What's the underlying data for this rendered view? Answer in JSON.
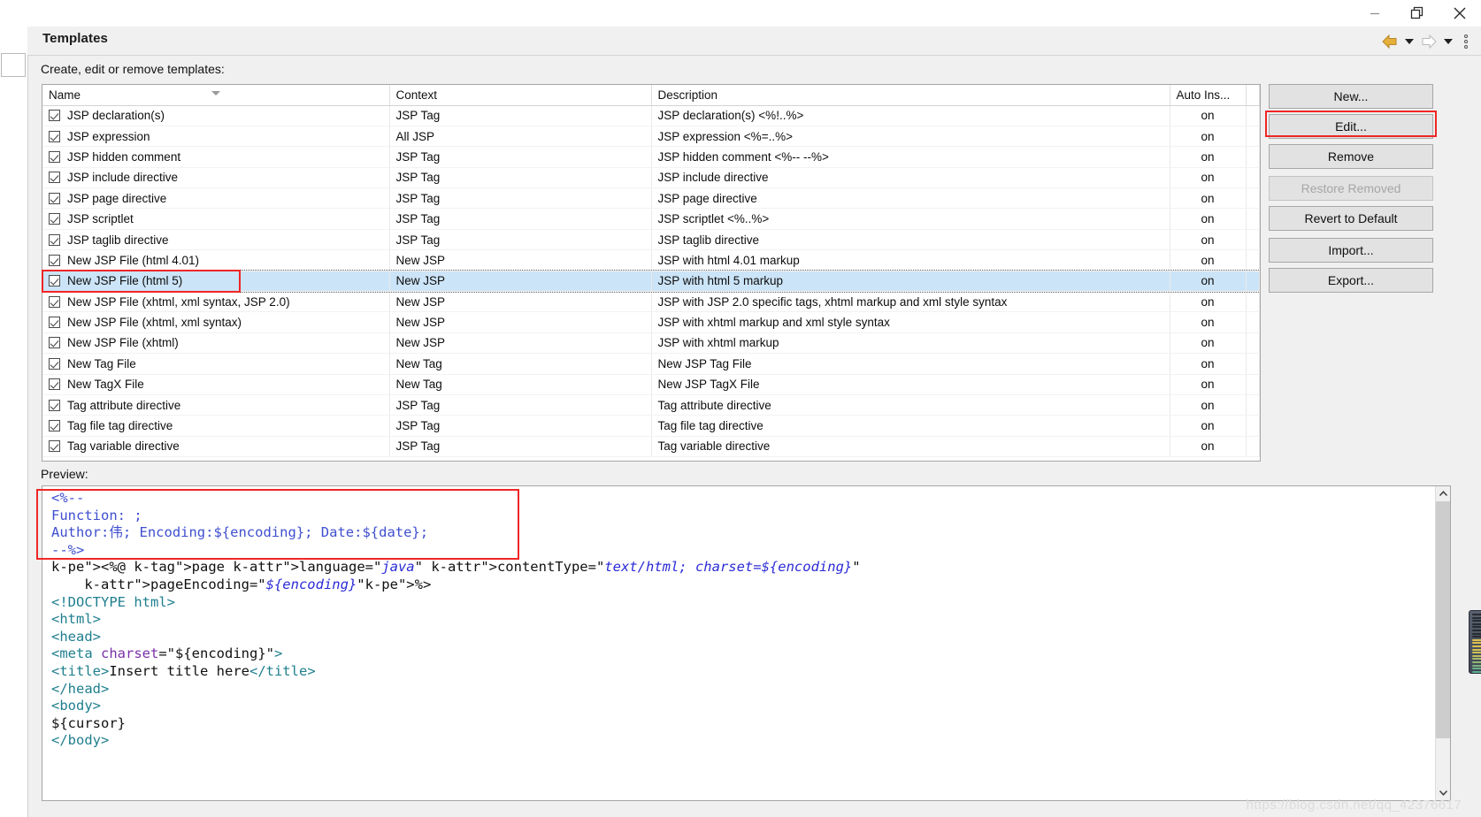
{
  "window": {
    "minimize_icon": "minimize-icon",
    "restore_icon": "restore-icon",
    "close_icon": "close-icon"
  },
  "header": {
    "title": "Templates",
    "subtitle": "Create, edit or remove templates:",
    "back_icon": "back-arrow-icon",
    "forward_icon": "forward-arrow-icon",
    "menu_icon": "view-menu-icon"
  },
  "table": {
    "columns": [
      "Name",
      "Context",
      "Description",
      "Auto Ins..."
    ],
    "rows": [
      {
        "checked": true,
        "name": "JSP declaration(s)",
        "context": "JSP Tag",
        "description": "JSP declaration(s) <%!..%>",
        "auto": "on",
        "selected": false
      },
      {
        "checked": true,
        "name": "JSP expression",
        "context": "All JSP",
        "description": "JSP expression <%=..%>",
        "auto": "on",
        "selected": false
      },
      {
        "checked": true,
        "name": "JSP hidden comment",
        "context": "JSP Tag",
        "description": "JSP hidden comment <%-- --%>",
        "auto": "on",
        "selected": false
      },
      {
        "checked": true,
        "name": "JSP include directive",
        "context": "JSP Tag",
        "description": "JSP include directive",
        "auto": "on",
        "selected": false
      },
      {
        "checked": true,
        "name": "JSP page directive",
        "context": "JSP Tag",
        "description": "JSP page directive",
        "auto": "on",
        "selected": false
      },
      {
        "checked": true,
        "name": "JSP scriptlet",
        "context": "JSP Tag",
        "description": "JSP scriptlet <%..%>",
        "auto": "on",
        "selected": false
      },
      {
        "checked": true,
        "name": "JSP taglib directive",
        "context": "JSP Tag",
        "description": "JSP taglib directive",
        "auto": "on",
        "selected": false
      },
      {
        "checked": true,
        "name": "New JSP File (html 4.01)",
        "context": "New JSP",
        "description": "JSP with html 4.01 markup",
        "auto": "on",
        "selected": false
      },
      {
        "checked": true,
        "name": "New JSP File (html 5)",
        "context": "New JSP",
        "description": "JSP with html 5 markup",
        "auto": "on",
        "selected": true
      },
      {
        "checked": true,
        "name": "New JSP File (xhtml, xml syntax, JSP 2.0)",
        "context": "New JSP",
        "description": "JSP with JSP 2.0 specific tags, xhtml markup and xml style syntax",
        "auto": "on",
        "selected": false
      },
      {
        "checked": true,
        "name": "New JSP File (xhtml, xml syntax)",
        "context": "New JSP",
        "description": "JSP with xhtml markup and xml style syntax",
        "auto": "on",
        "selected": false
      },
      {
        "checked": true,
        "name": "New JSP File (xhtml)",
        "context": "New JSP",
        "description": "JSP with xhtml markup",
        "auto": "on",
        "selected": false
      },
      {
        "checked": true,
        "name": "New Tag File",
        "context": "New Tag",
        "description": "New JSP Tag File",
        "auto": "on",
        "selected": false
      },
      {
        "checked": true,
        "name": "New TagX File",
        "context": "New Tag",
        "description": "New JSP TagX File",
        "auto": "on",
        "selected": false
      },
      {
        "checked": true,
        "name": "Tag attribute directive",
        "context": "JSP Tag",
        "description": "Tag attribute directive",
        "auto": "on",
        "selected": false
      },
      {
        "checked": true,
        "name": "Tag file tag directive",
        "context": "JSP Tag",
        "description": "Tag file tag directive",
        "auto": "on",
        "selected": false
      },
      {
        "checked": true,
        "name": "Tag variable directive",
        "context": "JSP Tag",
        "description": "Tag variable directive",
        "auto": "on",
        "selected": false
      }
    ]
  },
  "buttons": {
    "new": "New...",
    "edit": "Edit...",
    "remove": "Remove",
    "restore_removed": "Restore Removed",
    "revert_to_default": "Revert to Default",
    "import": "Import...",
    "export": "Export..."
  },
  "preview": {
    "label": "Preview:",
    "code_lines": [
      "<%--",
      "Function: ;",
      "Author:伟; Encoding:${encoding}; Date:${date};",
      "--%>",
      "<%@ page language=\"java\" contentType=\"text/html; charset=${encoding}\"",
      "    pageEncoding=\"${encoding}\"%>",
      "<!DOCTYPE html>",
      "<html>",
      "<head>",
      "<meta charset=\"${encoding}\">",
      "<title>Insert title here</title>",
      "</head>",
      "<body>",
      "${cursor}",
      "</body>"
    ]
  },
  "colors": {
    "highlight_red": "#ef2626",
    "selection_blue": "#cce4f7",
    "comment_blue": "#3f4fd0",
    "directive_orange": "#c86a2a",
    "attribute_purple": "#7b2fa8",
    "string_blue": "#2b2bd6",
    "tag_teal": "#1f7f8e"
  },
  "watermark": "https://blog.csdn.net/qq_42376617"
}
